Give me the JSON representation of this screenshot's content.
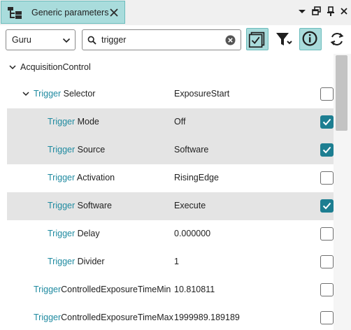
{
  "panel": {
    "title": "Generic parameters"
  },
  "toolbar": {
    "visibility_selected": "Guru",
    "search_value": "trigger",
    "search_placeholder": ""
  },
  "tree": {
    "root": {
      "label": "AcquisitionControl",
      "expanded": true
    },
    "rows": [
      {
        "prefix": "Trigger",
        "suffix": " Selector",
        "value": "ExposureStart",
        "checked": false,
        "highlighted": false,
        "expandable": true
      },
      {
        "prefix": "Trigger",
        "suffix": " Mode",
        "value": "Off",
        "checked": true,
        "highlighted": true,
        "expandable": false
      },
      {
        "prefix": "Trigger",
        "suffix": " Source",
        "value": "Software",
        "checked": true,
        "highlighted": true,
        "expandable": false
      },
      {
        "prefix": "Trigger",
        "suffix": " Activation",
        "value": "RisingEdge",
        "checked": false,
        "highlighted": false,
        "expandable": false
      },
      {
        "prefix": "Trigger",
        "suffix": " Software",
        "value": "Execute",
        "checked": true,
        "highlighted": true,
        "expandable": false
      },
      {
        "prefix": "Trigger",
        "suffix": " Delay",
        "value": "0.000000",
        "checked": false,
        "highlighted": false,
        "expandable": false
      },
      {
        "prefix": "Trigger",
        "suffix": " Divider",
        "value": "1",
        "checked": false,
        "highlighted": false,
        "expandable": false
      },
      {
        "prefix": "Trigger",
        "suffix": "ControlledExposureTimeMin",
        "value": "10.810811",
        "checked": false,
        "highlighted": false,
        "expandable": false
      },
      {
        "prefix": "Trigger",
        "suffix": "ControlledExposureTimeMax",
        "value": "1999989.189189",
        "checked": false,
        "highlighted": false,
        "expandable": false
      }
    ]
  },
  "colors": {
    "accent": "#1d7e91",
    "keyword": "#1f8aa0",
    "tab_bg": "#a9dcdc",
    "row_highlight": "#e4e4e4"
  },
  "icons": {
    "tab": "parameter-tree-icon",
    "close": "close-icon",
    "float": "float-window-icon",
    "pin": "pin-icon",
    "menu": "dropdown-menu-icon",
    "search": "search-icon",
    "clear": "clear-icon",
    "checklist": "checklist-icon",
    "filter": "filter-icon",
    "info": "info-icon",
    "refresh": "refresh-icon"
  }
}
